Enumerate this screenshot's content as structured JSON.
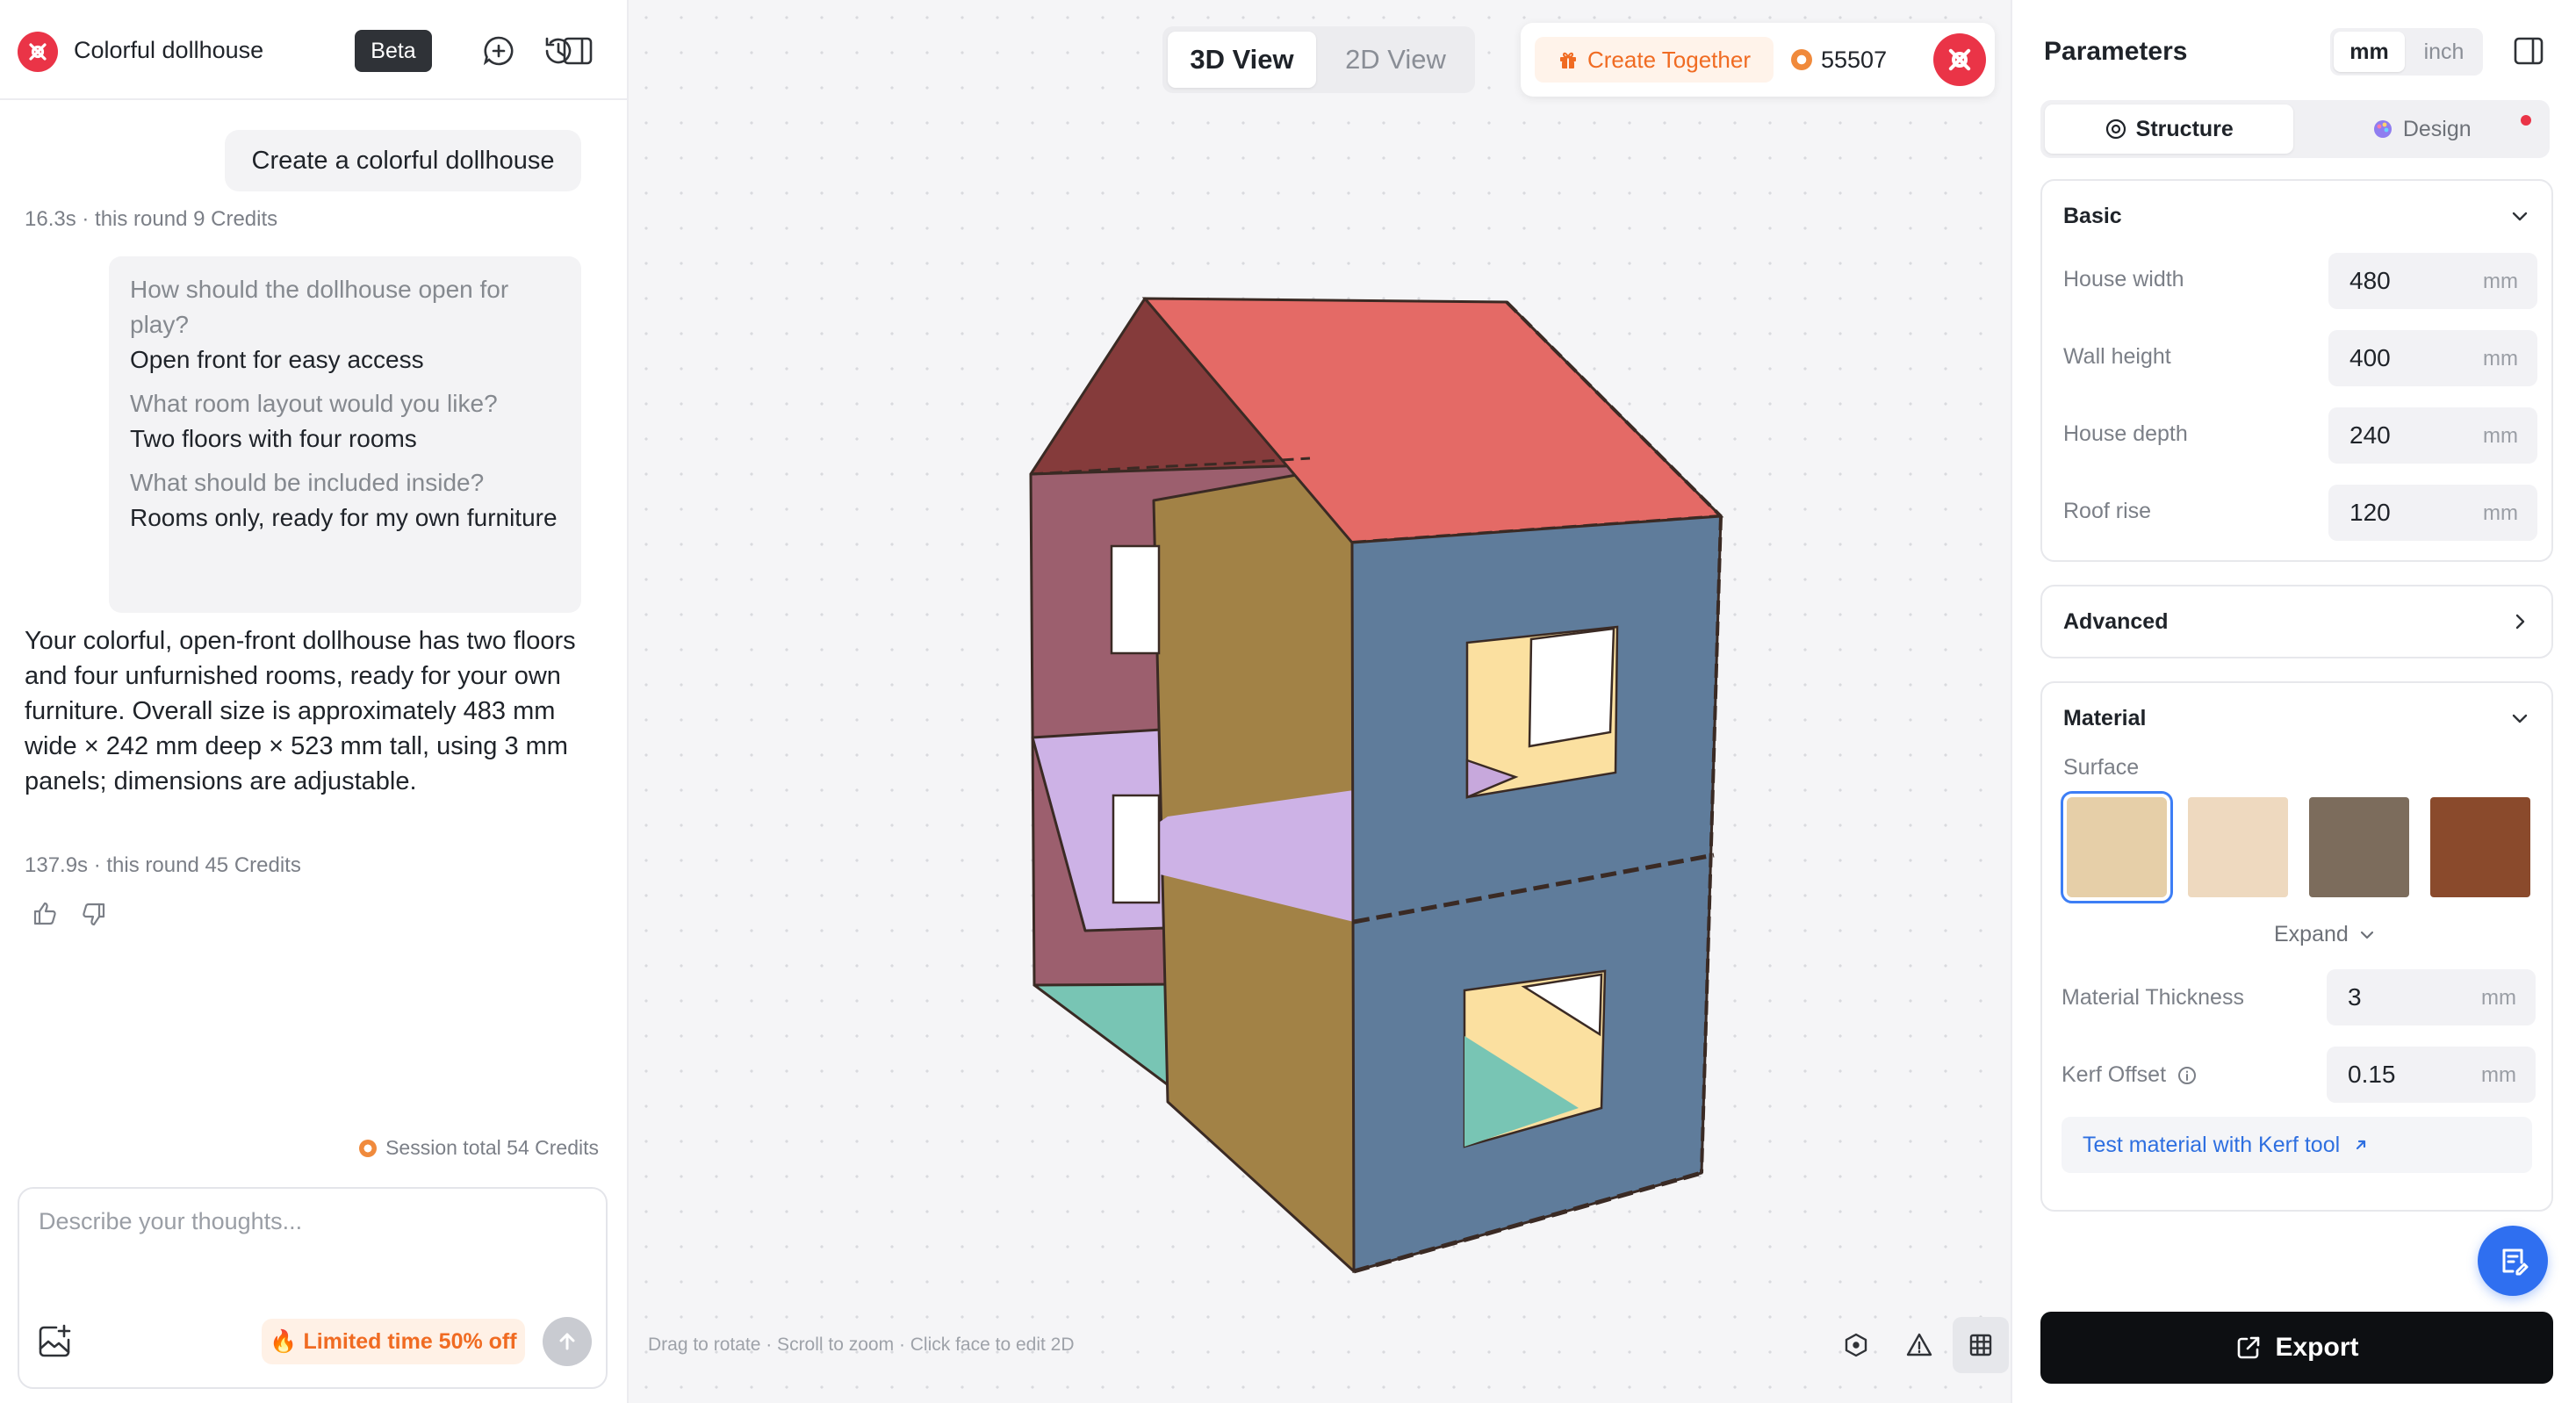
{
  "app": {
    "title": "Colorful dollhouse",
    "beta_label": "Beta",
    "logo_icon": "brand-logo-icon",
    "brand_color": "#ea3447"
  },
  "chat": {
    "user_message": "Create a colorful dollhouse",
    "first_meta": "16.3s · this round 9 Credits",
    "qa": [
      {
        "question": "How should the dollhouse open for play?",
        "answer": "Open front for easy access"
      },
      {
        "question": "What room layout would you like?",
        "answer": "Two floors with four rooms"
      },
      {
        "question": "What should be included inside?",
        "answer": "Rooms only, ready for my own furniture"
      }
    ],
    "assistant_answer": "Your colorful, open-front dollhouse has two floors and four unfurnished rooms, ready for your own furniture. Overall size is approximately 483 mm wide × 242 mm deep × 523 mm tall, using 3 mm panels; dimensions are adjustable.",
    "second_meta": "137.9s · this round 45 Credits",
    "session_total": "Session total 54 Credits",
    "input_placeholder": "Describe your thoughts...",
    "promo_label": "🔥 Limited time 50% off"
  },
  "viewport": {
    "view_tabs": [
      "3D View",
      "2D View"
    ],
    "active_view": "3D View",
    "create_together_label": "Create Together",
    "credits_count": "55507",
    "hint_text": "Drag to rotate  ·  Scroll to zoom  ·  Click face to edit 2D",
    "tools": [
      "cube-icon",
      "warning-icon",
      "grid-icon"
    ],
    "colors": {
      "roof": "#e46a66",
      "roof_gable": "#853b3b",
      "side_wall": "#9c5f6e",
      "divider": "#a28246",
      "front_wall": "#5f7c9b",
      "floor_upper": "#cdb2e6",
      "floor_lower": "#78c5b4",
      "window_interior": "#fbe0a0"
    }
  },
  "parameters": {
    "title": "Parameters",
    "units": [
      "mm",
      "inch"
    ],
    "active_unit": "mm",
    "tabs": [
      "Structure",
      "Design"
    ],
    "active_tab": "Structure",
    "basic": {
      "title": "Basic",
      "fields": [
        {
          "label": "House width",
          "value": "480",
          "unit": "mm"
        },
        {
          "label": "Wall height",
          "value": "400",
          "unit": "mm"
        },
        {
          "label": "House depth",
          "value": "240",
          "unit": "mm"
        },
        {
          "label": "Roof rise",
          "value": "120",
          "unit": "mm"
        }
      ]
    },
    "advanced_title": "Advanced",
    "material": {
      "title": "Material",
      "surface_label": "Surface",
      "swatches": [
        "#e6cfa8",
        "#eed9bf",
        "#7c6c5c",
        "#8a4a2c"
      ],
      "selected_swatch": 0,
      "expand_label": "Expand",
      "thickness": {
        "label": "Material Thickness",
        "value": "3",
        "unit": "mm"
      },
      "kerf": {
        "label": "Kerf Offset",
        "value": "0.15",
        "unit": "mm"
      },
      "kerf_link": "Test material with Kerf tool"
    },
    "export_label": "Export"
  }
}
